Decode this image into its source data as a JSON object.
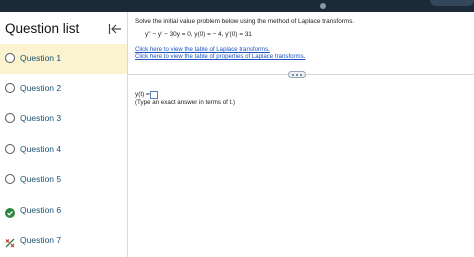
{
  "sidebar": {
    "title": "Question list",
    "collapse_icon": "collapse-left-icon",
    "items": [
      {
        "label": "Question 1",
        "state": "active",
        "icon": "circle-icon"
      },
      {
        "label": "Question 2",
        "state": "unanswered",
        "icon": "circle-icon"
      },
      {
        "label": "Question 3",
        "state": "unanswered",
        "icon": "circle-icon"
      },
      {
        "label": "Question 4",
        "state": "unanswered",
        "icon": "circle-icon"
      },
      {
        "label": "Question 5",
        "state": "unanswered",
        "icon": "circle-icon"
      },
      {
        "label": "Question 6",
        "state": "correct",
        "icon": "check-circle-icon"
      },
      {
        "label": "Question 7",
        "state": "partial",
        "icon": "partial-credit-icon"
      }
    ]
  },
  "question": {
    "instruction": "Solve the initial value problem below using the method of Laplace transforms.",
    "equation": "y'' − y' − 30y = 0, y(0) = − 4, y'(0) = 31",
    "link_table": "Click here to view the table of Laplace transforms.",
    "link_properties": "Click here to view the table of properties of Laplace transforms.",
    "more_icon": "ellipsis-icon"
  },
  "answer": {
    "prefix": "y(t) =",
    "value": "",
    "hint": "(Type an exact answer in terms of t.)"
  },
  "colors": {
    "active_bg": "#fbf2cf",
    "link": "#1f55c2",
    "question_label": "#1a5276",
    "correct": "#2e8540",
    "partial_slash": "#2e8540",
    "partial_mark": "#c0392b",
    "topbar": "#1c2a38"
  }
}
